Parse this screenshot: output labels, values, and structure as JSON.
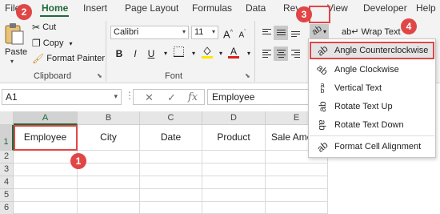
{
  "tabs": [
    "File",
    "Home",
    "Insert",
    "Page Layout",
    "Formulas",
    "Data",
    "Review",
    "View",
    "Developer",
    "Help"
  ],
  "active_tab": "Home",
  "clipboard": {
    "paste_label": "Paste",
    "cut_label": "Cut",
    "copy_label": "Copy",
    "format_painter_label": "Format Painter",
    "group_label": "Clipboard"
  },
  "font": {
    "font_name": "Calibri",
    "font_size": "11",
    "bold": "B",
    "italic": "I",
    "underline": "U",
    "grow": "A",
    "shrink": "A",
    "font_color": "A",
    "group_label": "Font"
  },
  "alignment": {
    "wrap_text_label": "Wrap Text"
  },
  "orientation_menu": {
    "items": [
      {
        "label": "Angle Counterclockwise",
        "icon": "angle-ccw-icon"
      },
      {
        "label": "Angle Clockwise",
        "icon": "angle-cw-icon"
      },
      {
        "label": "Vertical Text",
        "icon": "vertical-text-icon"
      },
      {
        "label": "Rotate Text Up",
        "icon": "rotate-up-icon"
      },
      {
        "label": "Rotate Text Down",
        "icon": "rotate-down-icon"
      },
      {
        "label": "Format Cell Alignment",
        "icon": "format-alignment-icon"
      }
    ]
  },
  "formula_bar": {
    "name_box": "A1",
    "fx": "fx",
    "value": "Employee"
  },
  "sheet": {
    "columns": [
      "A",
      "B",
      "C",
      "D",
      "E"
    ],
    "rows": [
      "1",
      "2",
      "3",
      "4",
      "5",
      "6"
    ],
    "header_row": [
      "Employee",
      "City",
      "Date",
      "Product",
      "Sale Amo"
    ]
  },
  "callouts": [
    "1",
    "2",
    "3",
    "4"
  ],
  "colors": {
    "accent": "#1e6a39",
    "highlight": "#e04646"
  }
}
